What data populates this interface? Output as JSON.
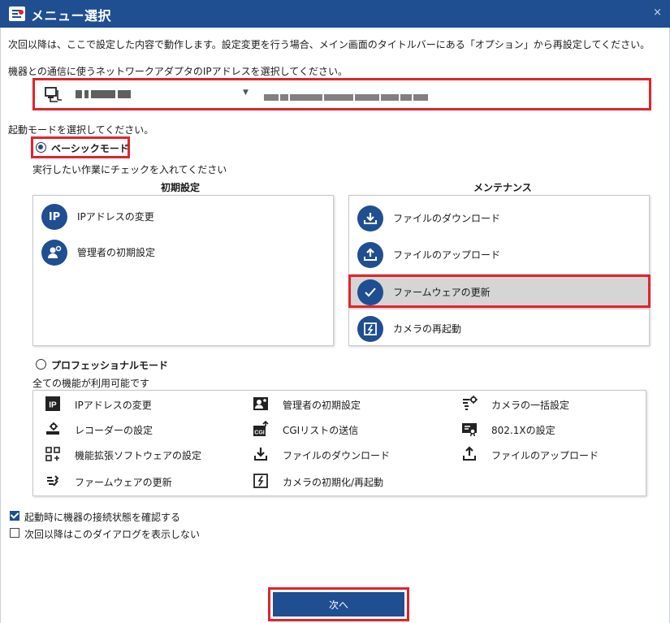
{
  "window": {
    "title": "メニュー選択",
    "close_glyph": "×",
    "app_icon": "app-logo-icon"
  },
  "intro_text": "次回以降は、ここで設定した内容で動作します。設定変更を行う場合、メイン画面のタイトルバーにある「オプション」から再設定してください。",
  "adapter": {
    "prompt": "機器との通信に使うネットワークアダプタのIPアドレスを選択してください。",
    "selected_value": "(blurred adapter address)",
    "icon": "computer-network-icon"
  },
  "mode": {
    "prompt": "起動モードを選択してください。",
    "basic": {
      "label": "ベーシックモード",
      "selected": true,
      "hint": "実行したい作業にチェックを入れてください"
    },
    "professional": {
      "label": "プロフェッショナルモード",
      "selected": false,
      "hint": "全ての機能が利用可能です"
    }
  },
  "initial_settings": {
    "heading": "初期設定",
    "items": [
      {
        "label": "IPアドレスの変更",
        "icon": "ip-address-icon"
      },
      {
        "label": "管理者の初期設定",
        "icon": "admin-user-icon"
      }
    ]
  },
  "maintenance": {
    "heading": "メンテナンス",
    "items": [
      {
        "label": "ファイルのダウンロード",
        "icon": "download-icon",
        "selected": false
      },
      {
        "label": "ファイルのアップロード",
        "icon": "upload-icon",
        "selected": false
      },
      {
        "label": "ファームウェアの更新",
        "icon": "checkmark-icon",
        "selected": true
      },
      {
        "label": "カメラの再起動",
        "icon": "restart-icon",
        "selected": false
      }
    ]
  },
  "pro_functions": [
    {
      "label": "IPアドレスの変更",
      "icon": "ip-address-icon"
    },
    {
      "label": "管理者の初期設定",
      "icon": "admin-user-icon"
    },
    {
      "label": "カメラの一括設定",
      "icon": "batch-settings-icon"
    },
    {
      "label": "レコーダーの設定",
      "icon": "recorder-settings-icon"
    },
    {
      "label": "CGIリストの送信",
      "icon": "cgi-upload-icon"
    },
    {
      "label": "802.1Xの設定",
      "icon": "security-cert-icon"
    },
    {
      "label": "機能拡張ソフトウェアの設定",
      "icon": "extension-apps-icon"
    },
    {
      "label": "ファイルのダウンロード",
      "icon": "download-icon"
    },
    {
      "label": "ファイルのアップロード",
      "icon": "upload-icon"
    },
    {
      "label": "ファームウェアの更新",
      "icon": "firmware-update-icon"
    },
    {
      "label": "カメラの初期化/再起動",
      "icon": "restart-icon"
    }
  ],
  "options": {
    "check_connection": {
      "label": "起動時に機器の接続状態を確認する",
      "checked": true
    },
    "hide_dialog": {
      "label": "次回以降はこのダイアログを表示しない",
      "checked": false
    }
  },
  "next_button": {
    "label": "次へ"
  },
  "colors": {
    "accent": "#1f4e91",
    "highlight_red": "#e0242b",
    "selected_row": "#d5d5d5"
  }
}
